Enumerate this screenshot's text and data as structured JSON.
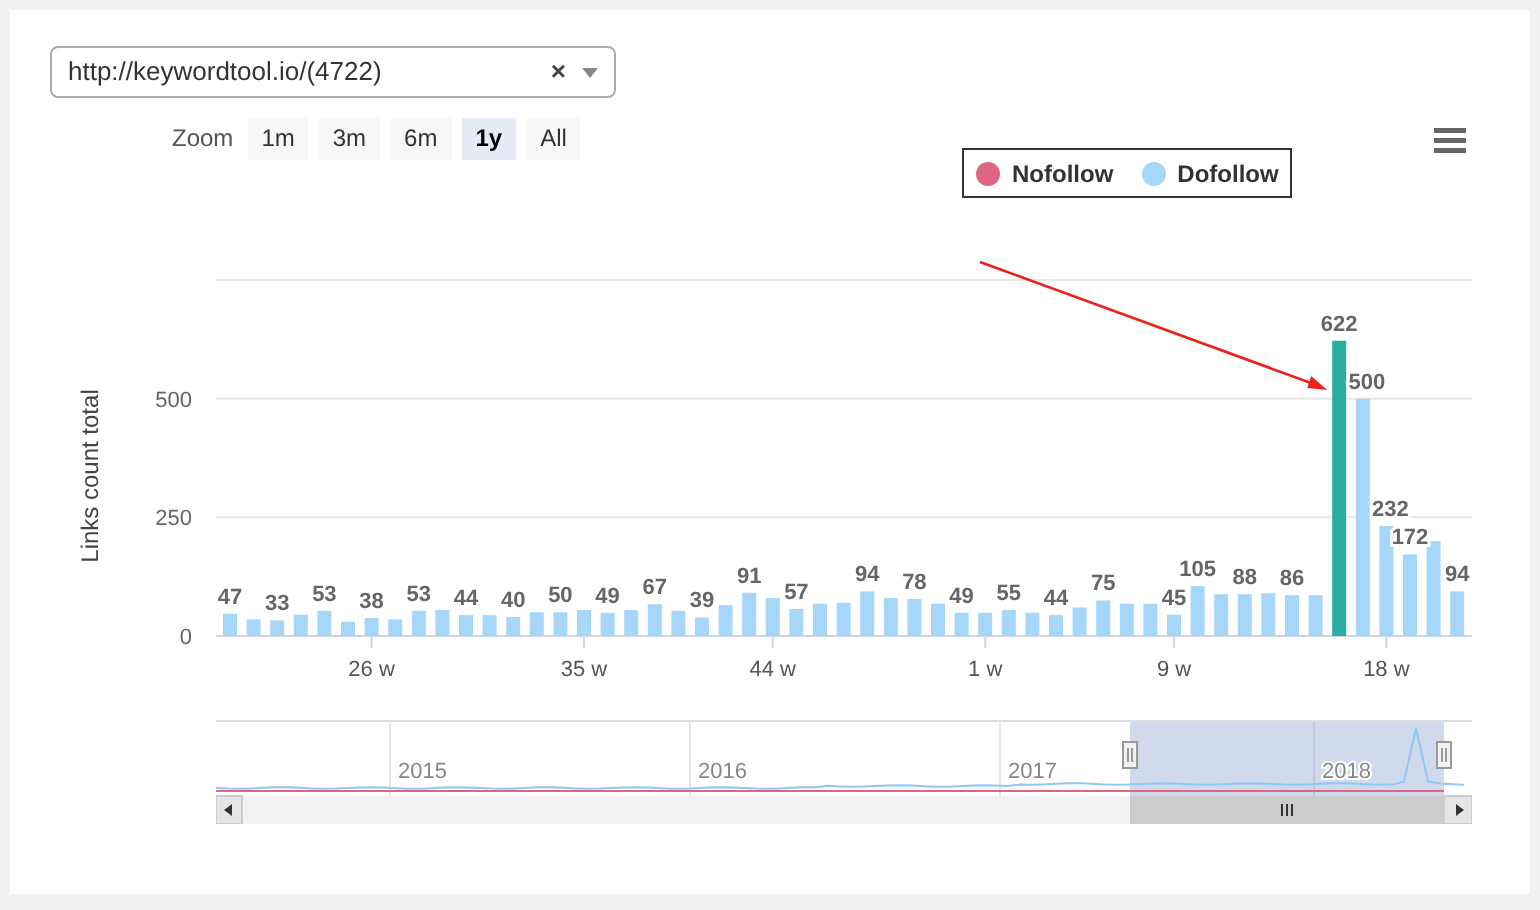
{
  "site_select": {
    "value": "http://keywordtool.io/(4722)",
    "clear": "×"
  },
  "zoom": {
    "label": "Zoom",
    "buttons": [
      {
        "label": "1m",
        "selected": false
      },
      {
        "label": "3m",
        "selected": false
      },
      {
        "label": "6m",
        "selected": false
      },
      {
        "label": "1y",
        "selected": true
      },
      {
        "label": "All",
        "selected": false
      }
    ]
  },
  "arrow": {
    "color": "#e8231b"
  },
  "chart_data": {
    "type": "bar",
    "ylabel": "Links count total",
    "ylim": [
      0,
      750
    ],
    "yticks": [
      0,
      250,
      500
    ],
    "categories": [
      null,
      null,
      null,
      null,
      null,
      null,
      "26 w",
      null,
      null,
      null,
      null,
      null,
      null,
      null,
      null,
      "35 w",
      null,
      null,
      null,
      null,
      null,
      null,
      null,
      "44 w",
      null,
      null,
      null,
      null,
      null,
      null,
      null,
      null,
      "1 w",
      null,
      null,
      null,
      null,
      null,
      null,
      null,
      "9 w",
      null,
      null,
      null,
      null,
      null,
      null,
      null,
      null,
      "18 w",
      null,
      null,
      null
    ],
    "series": [
      {
        "name": "Nofollow",
        "color": "#e06585",
        "values": [
          0,
          0,
          0,
          0,
          0,
          0,
          0,
          0,
          0,
          0,
          0,
          0,
          0,
          0,
          0,
          0,
          0,
          0,
          0,
          0,
          0,
          0,
          0,
          0,
          0,
          0,
          0,
          0,
          0,
          0,
          0,
          0,
          0,
          0,
          0,
          0,
          0,
          0,
          0,
          0,
          0,
          0,
          0,
          0,
          0,
          0,
          0,
          0,
          0,
          0,
          0,
          0,
          0
        ]
      },
      {
        "name": "Dofollow",
        "color": "#a6d7fb",
        "values": [
          47,
          35,
          33,
          45,
          53,
          30,
          38,
          35,
          53,
          55,
          44,
          44,
          40,
          50,
          50,
          55,
          49,
          55,
          67,
          53,
          39,
          65,
          91,
          80,
          57,
          68,
          70,
          94,
          80,
          78,
          68,
          49,
          49,
          55,
          49,
          44,
          60,
          75,
          68,
          68,
          45,
          105,
          88,
          88,
          90,
          86,
          86,
          null,
          500,
          232,
          172,
          200,
          94
        ]
      },
      {
        "color": "#2aaea2",
        "values": [
          null,
          null,
          null,
          null,
          null,
          null,
          null,
          null,
          null,
          null,
          null,
          null,
          null,
          null,
          null,
          null,
          null,
          null,
          null,
          null,
          null,
          null,
          null,
          null,
          null,
          null,
          null,
          null,
          null,
          null,
          null,
          null,
          null,
          null,
          null,
          null,
          null,
          null,
          null,
          null,
          null,
          null,
          null,
          null,
          null,
          null,
          null,
          622,
          null,
          null,
          null,
          null,
          null
        ]
      }
    ],
    "value_labels": [
      "47",
      null,
      "33",
      null,
      "53",
      null,
      "38",
      null,
      "53",
      null,
      "44",
      null,
      "40",
      null,
      "50",
      null,
      "49",
      null,
      "67",
      null,
      "39",
      null,
      "91",
      null,
      "57",
      null,
      null,
      "94",
      null,
      "78",
      null,
      "49",
      null,
      "55",
      null,
      "44",
      null,
      "75",
      null,
      null,
      "45",
      "105",
      null,
      "88",
      null,
      "86",
      null,
      "622",
      "500",
      "232",
      "172",
      null,
      "94"
    ]
  },
  "navigator": {
    "labels": [
      "2015",
      "2016",
      "2017",
      "2018"
    ]
  }
}
